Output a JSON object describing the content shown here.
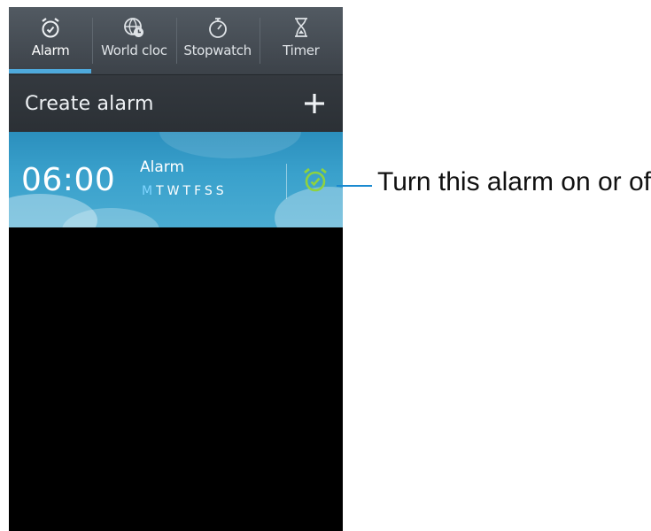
{
  "tabs": [
    {
      "label": "Alarm",
      "icon": "alarm-clock-icon",
      "active": true
    },
    {
      "label": "World cloc",
      "icon": "globe-clock-icon",
      "active": false
    },
    {
      "label": "Stopwatch",
      "icon": "stopwatch-icon",
      "active": false
    },
    {
      "label": "Timer",
      "icon": "hourglass-icon",
      "active": false
    }
  ],
  "create": {
    "label": "Create alarm",
    "icon": "plus-icon"
  },
  "alarm": {
    "time": "06:00",
    "name": "Alarm",
    "days": [
      "M",
      "T",
      "W",
      "T",
      "F",
      "S",
      "S"
    ],
    "active_day": "M",
    "enabled": true,
    "toggle_icon": "alarm-clock-icon"
  },
  "callout": {
    "text": "Turn this alarm on or off."
  },
  "colors": {
    "accent": "#4ea9dc",
    "alarm_on": "#8ed23f",
    "callout_line": "#1a8ad0",
    "row_bg": "#3aa1cc"
  }
}
